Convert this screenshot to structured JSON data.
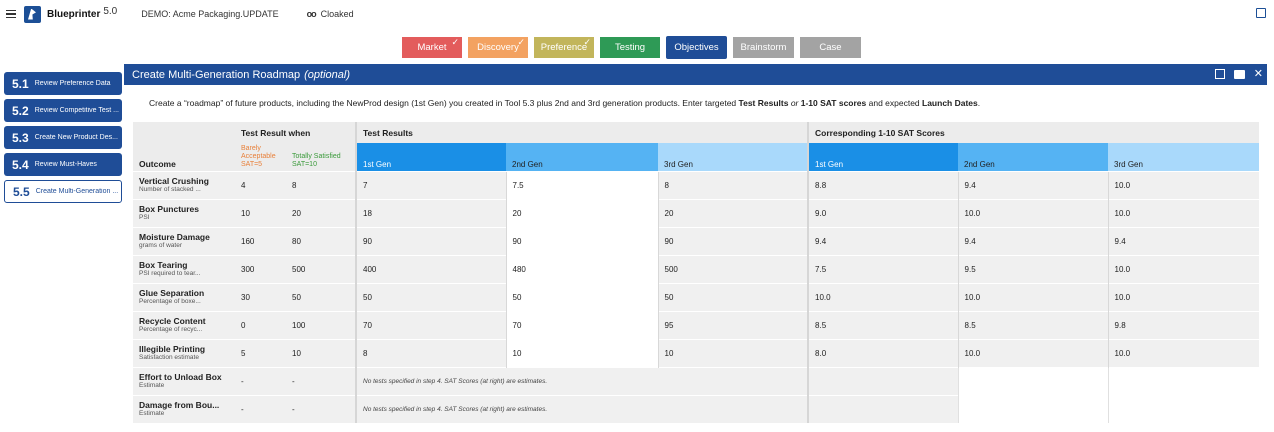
{
  "app": {
    "name": "Blueprinter",
    "version": "5.0",
    "demo": "DEMO: Acme Packaging.UPDATE",
    "cloak": "Cloaked"
  },
  "tabs": [
    {
      "label": "Market",
      "color": "#e35c5c",
      "width": 60,
      "checked": true
    },
    {
      "label": "Discovery",
      "color": "#f3a261",
      "width": 60,
      "checked": true
    },
    {
      "label": "Preference",
      "color": "#c2b55b",
      "width": 60,
      "checked": true
    },
    {
      "label": "Testing",
      "color": "#2e9a56",
      "width": 60,
      "checked": false
    },
    {
      "label": "Objectives",
      "color": "#1f4d97",
      "width": 61,
      "checked": false
    },
    {
      "label": "Brainstorm",
      "color": "#a3a3a3",
      "width": 61,
      "checked": false
    },
    {
      "label": "Case",
      "color": "#a3a3a3",
      "width": 61,
      "checked": false
    }
  ],
  "sidebar": [
    {
      "num": "5.1",
      "label": "Review Preference Data"
    },
    {
      "num": "5.2",
      "label": "Review Competitive Test ..."
    },
    {
      "num": "5.3",
      "label": "Create New Product Des..."
    },
    {
      "num": "5.4",
      "label": "Review Must-Haves"
    },
    {
      "num": "5.5",
      "label": "Create Multi-Generation ..."
    }
  ],
  "panel": {
    "title": "Create Multi-Generation Roadmap",
    "title_optional": "(optional)",
    "intro": {
      "a": "Create a “roadmap” of future products, including the NewProd design (1st Gen) you created in Tool 5.3 plus 2nd and 3rd generation products. Enter targeted ",
      "b": "Test Results",
      "c": " or ",
      "d": "1-10 SAT scores",
      "e": " and expected ",
      "f": "Launch Dates",
      "g": "."
    }
  },
  "table": {
    "header": {
      "test_result_when": "Test Result when",
      "test_results": "Test Results",
      "sat_scores": "Corresponding 1-10 SAT Scores",
      "outcome": "Outcome",
      "barely": "Barely Acceptable SAT=5",
      "totally": "Totally Satisfied SAT=10",
      "gen1": "1st Gen",
      "gen2": "2nd Gen",
      "gen3": "3rd Gen"
    },
    "rows": [
      {
        "name": "Vertical Crushing",
        "sub": "Number of stacked ...",
        "barely": "4",
        "totally": "8",
        "t1": "7",
        "t2": "7.5",
        "t3": "8",
        "s1": "8.8",
        "s2": "9.4",
        "s3": "10.0"
      },
      {
        "name": "Box Punctures",
        "sub": "PSI",
        "barely": "10",
        "totally": "20",
        "t1": "18",
        "t2": "20",
        "t3": "20",
        "s1": "9.0",
        "s2": "10.0",
        "s3": "10.0"
      },
      {
        "name": "Moisture Damage",
        "sub": "grams of water",
        "barely": "160",
        "totally": "80",
        "t1": "90",
        "t2": "90",
        "t3": "90",
        "s1": "9.4",
        "s2": "9.4",
        "s3": "9.4"
      },
      {
        "name": "Box Tearing",
        "sub": "PSI required to tear...",
        "barely": "300",
        "totally": "500",
        "t1": "400",
        "t2": "480",
        "t3": "500",
        "s1": "7.5",
        "s2": "9.5",
        "s3": "10.0"
      },
      {
        "name": "Glue Separation",
        "sub": "Percentage of boxe...",
        "barely": "30",
        "totally": "50",
        "t1": "50",
        "t2": "50",
        "t3": "50",
        "s1": "10.0",
        "s2": "10.0",
        "s3": "10.0"
      },
      {
        "name": "Recycle Content",
        "sub": "Percentage of recyc...",
        "barely": "0",
        "totally": "100",
        "t1": "70",
        "t2": "70",
        "t3": "95",
        "s1": "8.5",
        "s2": "8.5",
        "s3": "9.8"
      },
      {
        "name": "Illegible Printing",
        "sub": "Satisfaction estimate",
        "barely": "5",
        "totally": "10",
        "t1": "8",
        "t2": "10",
        "t3": "10",
        "s1": "8.0",
        "s2": "10.0",
        "s3": "10.0"
      }
    ],
    "estimate_rows": [
      {
        "name": "Effort to Unload Box",
        "sub": "Estimate",
        "barely": "-",
        "totally": "-",
        "note": "No tests specified in step 4. SAT Scores (at right) are estimates."
      },
      {
        "name": "Damage from Bou...",
        "sub": "Estimate",
        "barely": "-",
        "totally": "-",
        "note": "No tests specified in step 4. SAT Scores (at right) are estimates."
      }
    ]
  }
}
